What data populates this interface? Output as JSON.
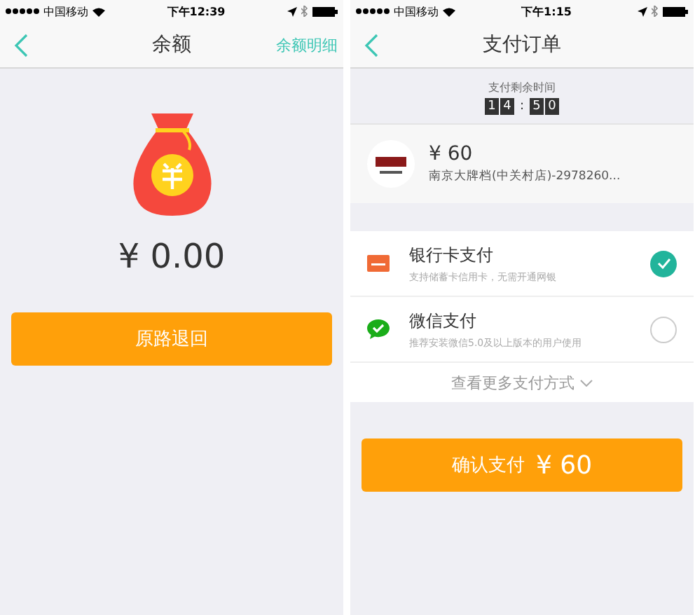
{
  "screens": [
    {
      "kind": "balance",
      "status_bar": {
        "carrier": "中国移动",
        "time": "下午12:39"
      },
      "nav": {
        "title": "余额",
        "action": "余额明细"
      },
      "amount": "¥ 0.00",
      "button": "原路退回"
    },
    {
      "kind": "payment",
      "status_bar": {
        "carrier": "中国移动",
        "time": "下午1:15"
      },
      "nav": {
        "title": "支付订单"
      },
      "timer": {
        "label": "支付剩余时间",
        "groups": [
          [
            "1",
            "4"
          ],
          [
            "5",
            "0"
          ]
        ],
        "separator": ":"
      },
      "merchant": {
        "price": "¥ 60",
        "name": "南京大牌档(中关村店)-2978260..."
      },
      "methods": [
        {
          "kind": "card",
          "name": "银行卡支付",
          "hint": "支持储蓄卡信用卡，无需开通网银",
          "selected": true
        },
        {
          "kind": "wechat",
          "name": "微信支付",
          "hint": "推荐安装微信5.0及以上版本的用户使用",
          "selected": false
        }
      ],
      "more": "查看更多支付方式",
      "button_label": "确认支付",
      "button_amount": "¥ 60"
    }
  ]
}
